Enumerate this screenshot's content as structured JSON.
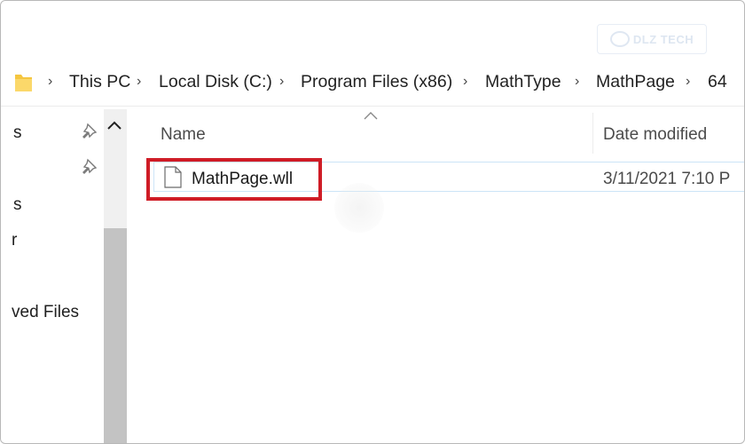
{
  "watermark": {
    "text": "DLZ TECH"
  },
  "breadcrumb": [
    "This PC",
    "Local Disk (C:)",
    "Program Files (x86)",
    "MathType",
    "MathPage",
    "64"
  ],
  "nav_pane": {
    "items": [
      "s",
      "s",
      "r",
      "ved Files"
    ]
  },
  "columns": {
    "name": "Name",
    "date_modified": "Date modified"
  },
  "files": [
    {
      "name": "MathPage.wll",
      "date_modified": "3/11/2021 7:10 P",
      "selected": true
    }
  ],
  "colors": {
    "highlight": "#cf1c26",
    "selection_border": "#cce4f7",
    "folder": "#f5c640",
    "scrollbar_thumb": "#c3c3c3"
  },
  "icons": [
    "folder-icon",
    "chevron-right-icon",
    "pin-icon",
    "chevron-up-icon",
    "sort-up-icon",
    "file-icon"
  ]
}
